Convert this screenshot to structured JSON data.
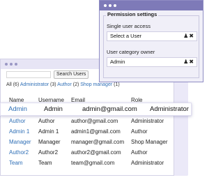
{
  "users_window": {
    "search_button": "Search Users",
    "filters": {
      "all": "All (6)",
      "administrator": "Administrator",
      "administrator_count": "(3)",
      "author": "Author",
      "author_count": "(2)",
      "shop_manager": "Shop manager",
      "shop_manager_count": "(1)"
    },
    "columns": [
      "Name",
      "Username",
      "Email",
      "Role"
    ],
    "highlight_row": {
      "name": "Admin",
      "username": "Admin",
      "email": "admin@gmail.com",
      "role": "Administrator"
    },
    "rows": [
      {
        "name": "Author",
        "username": "Author",
        "email": "author@gmail.com",
        "role": "Administrator"
      },
      {
        "name": "Admin 1",
        "username": "Admin 1",
        "email": "admin1@gmail.com",
        "role": "Author"
      },
      {
        "name": "Manager",
        "username": "Manager",
        "email": "manager@gmail.com",
        "role": "Shop Manager"
      },
      {
        "name": "Author2",
        "username": "Author2",
        "email": "author2@gmail.com",
        "role": "Author"
      },
      {
        "name": "Team",
        "username": "Team",
        "email": "team@gmail.com",
        "role": "Administrator"
      }
    ]
  },
  "permission_settings": {
    "title": "Permission settings",
    "single_user_label": "Single user access",
    "single_user_value": "Select a User",
    "category_label": "User category owner",
    "category_value": "Admin",
    "icons": [
      "user-icon",
      "close-icon"
    ]
  },
  "colors": {
    "accent": "#7e7ab8",
    "link": "#2f6fb6",
    "backdrop": "#ebe9f8"
  }
}
